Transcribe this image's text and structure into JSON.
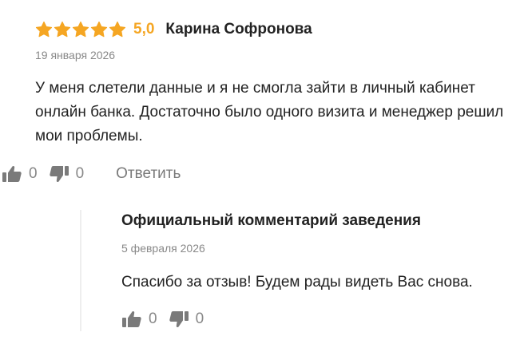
{
  "review": {
    "rating": {
      "stars_filled": 5,
      "stars_total": 5,
      "value_label": "5,0",
      "star_color": "#f5a623"
    },
    "author": "Карина Софронова",
    "date": "19 января 2026",
    "text": "У меня слетели данные и я не смогла зайти в личный кабинет онлайн банка. Достаточно было одного визита и менеджер решил мои проблемы.",
    "likes": "0",
    "dislikes": "0",
    "reply_label": "Ответить",
    "icons": {
      "like": "thumbs-up-icon",
      "dislike": "thumbs-down-icon",
      "star": "star-icon"
    }
  },
  "official_reply": {
    "title": "Официальный комментарий заведения",
    "date": "5 февраля 2026",
    "text": "Спасибо за отзыв! Будем рады видеть Вас снова.",
    "likes": "0",
    "dislikes": "0"
  },
  "colors": {
    "accent": "#f5a623",
    "muted_text": "#888888",
    "icon": "#7a7a7a",
    "divider": "#eeeeee"
  }
}
